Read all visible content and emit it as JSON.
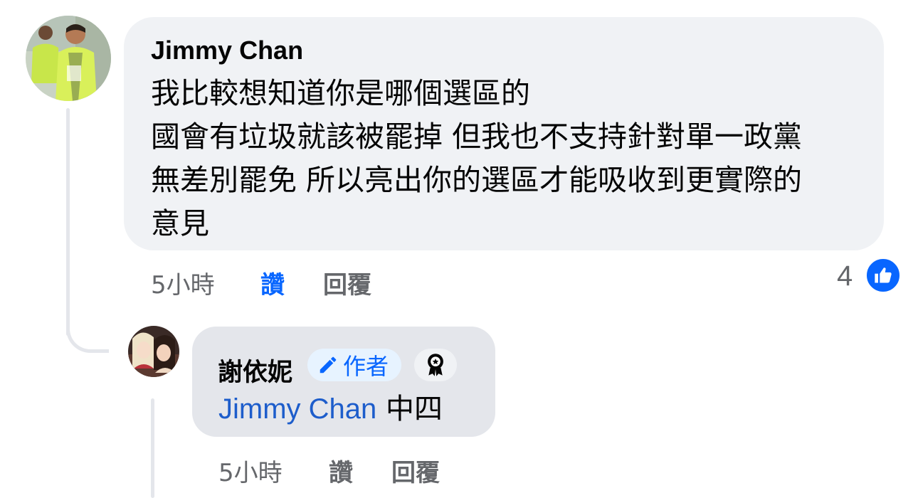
{
  "comments": [
    {
      "author": "Jimmy Chan",
      "lines": [
        "我比較想知道你是哪個選區的",
        "國會有垃圾就該被罷掉 但我也不支持針對單一政黨",
        "無差別罷免 所以亮出你的選區才能吸收到更實際的",
        "意見"
      ],
      "time": "5小時",
      "like_label": "讚",
      "reply_label": "回覆",
      "reaction_count": "4",
      "reaction_icon": "thumbs-up-icon",
      "colors": {
        "bubble": "#f0f2f5",
        "liked": "#0866ff"
      }
    }
  ],
  "reply": {
    "author": "謝依妮",
    "author_badge": "作者",
    "author_badge_icon": "pencil-icon",
    "award_icon": "top-fan-award-icon",
    "mention": "Jimmy Chan",
    "text": " 中四",
    "time": "5小時",
    "like_label": "讚",
    "reply_label": "回覆",
    "colors": {
      "bubble": "#e4e6eb",
      "mention": "#1d5dcb"
    }
  }
}
